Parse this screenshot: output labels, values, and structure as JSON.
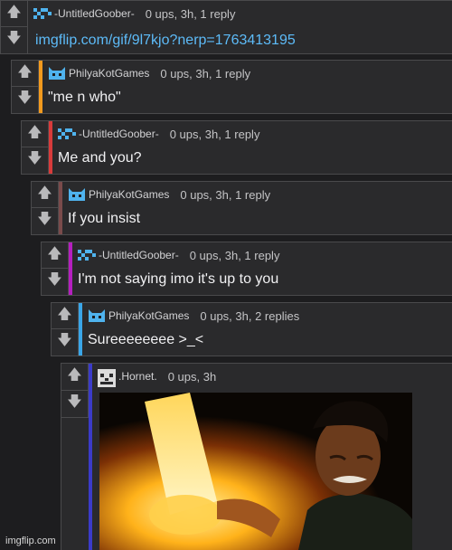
{
  "comments": [
    {
      "user": "-UntitledGoober-",
      "meta": "0 ups, 3h, 1 reply",
      "body": "imgflip.com/gif/9l7kjo?nerp=1763413195",
      "accent": "",
      "avatar": "goober-avatar-icon"
    },
    {
      "user": "PhilyaKotGames",
      "meta": "0 ups, 3h, 1 reply",
      "body": "\"me n who\"",
      "accent": "#f29a1e",
      "avatar": "cat-avatar-icon"
    },
    {
      "user": "-UntitledGoober-",
      "meta": "0 ups, 3h, 1 reply",
      "body": "Me and you?",
      "accent": "#d83b3b",
      "avatar": "goober-avatar-icon"
    },
    {
      "user": "PhilyaKotGames",
      "meta": "0 ups, 3h, 1 reply",
      "body": "If you insist",
      "accent": "#7a4b4b",
      "avatar": "cat-avatar-icon"
    },
    {
      "user": "-UntitledGoober-",
      "meta": "0 ups, 3h, 1 reply",
      "body": "I'm not saying imo it's up to you",
      "accent": "#b51fbf",
      "avatar": "goober-avatar-icon"
    },
    {
      "user": "PhilyaKotGames",
      "meta": "0 ups, 3h, 2 replies",
      "body": "Sureeeeeeee >_<",
      "accent": "#3aa6e8",
      "avatar": "cat-avatar-icon"
    },
    {
      "user": ".Hornet.",
      "meta": "0 ups, 3h",
      "body": "",
      "accent": "#3b3bc9",
      "avatar": "hornet-avatar-icon"
    }
  ],
  "vote": {
    "up": "🡅",
    "down": "🡇"
  },
  "watermark": "imgflip.com",
  "colors": {
    "background": "#1d1d1f",
    "panel": "#2a2a2c",
    "link": "#5dbbf8"
  }
}
